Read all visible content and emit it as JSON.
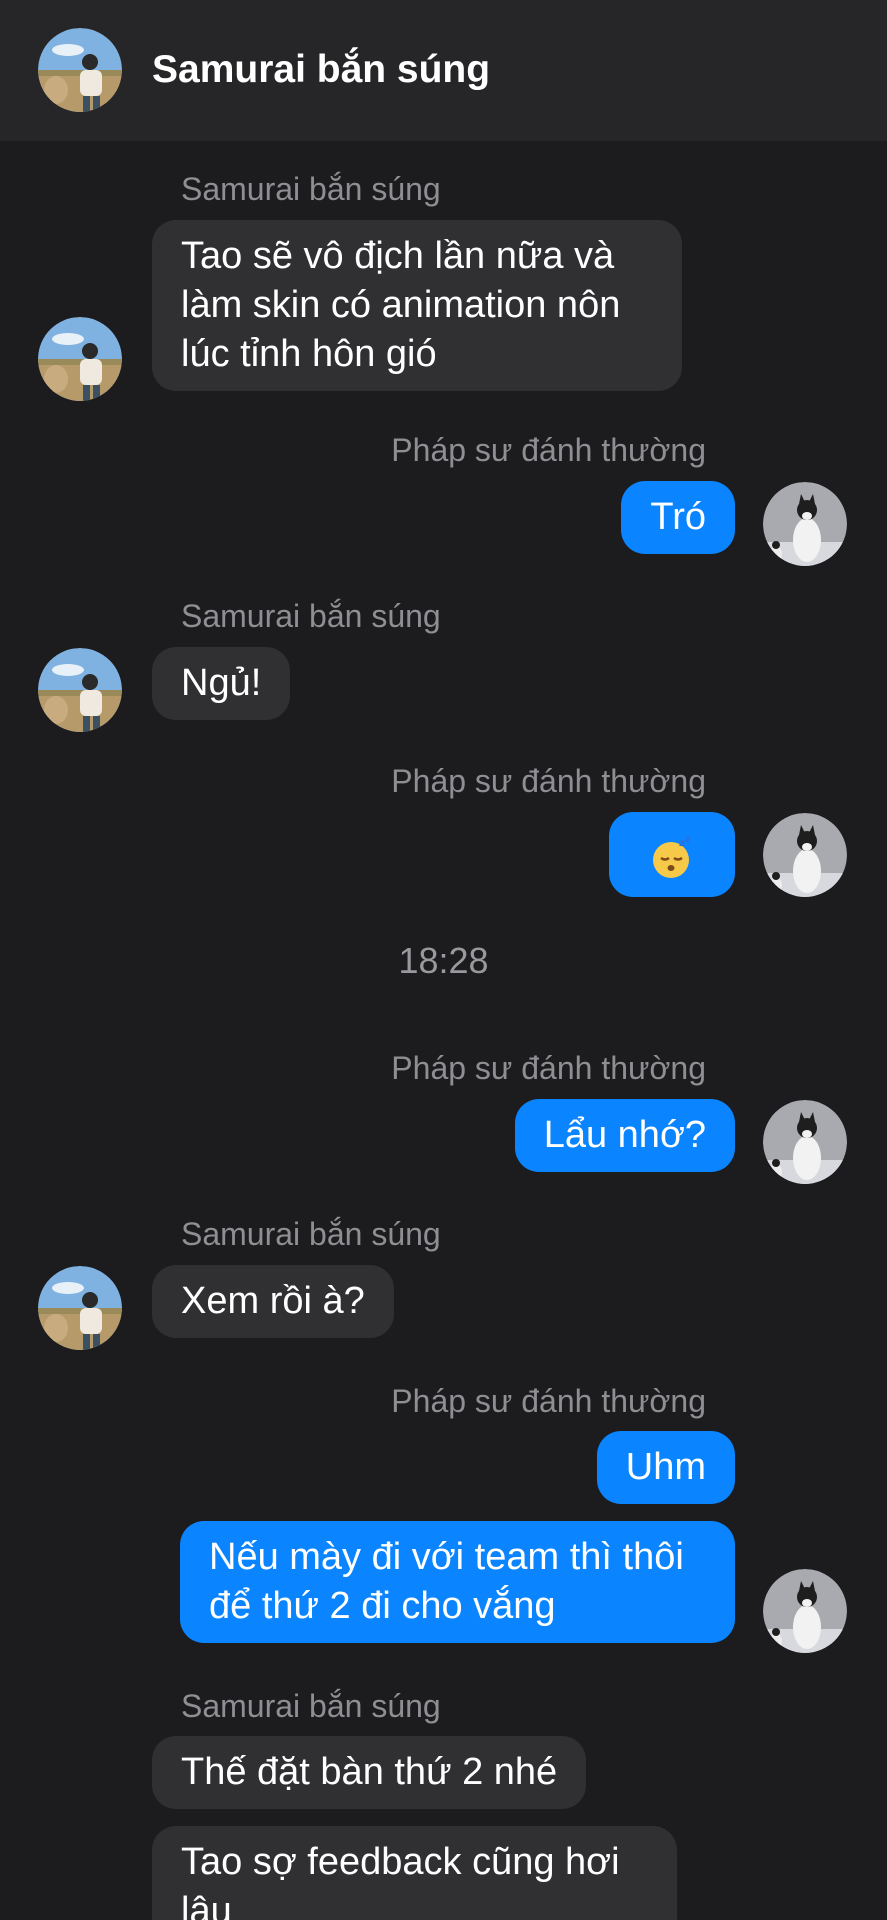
{
  "header": {
    "title": "Samurai bắn súng",
    "avatar_icon": "contact-photo-person-field"
  },
  "participants": {
    "them": {
      "name": "Samurai bắn súng",
      "avatar_icon": "person-in-field-photo"
    },
    "me": {
      "name": "Pháp sư đánh thường",
      "avatar_icon": "black-white-cat-photo"
    }
  },
  "messages": [
    {
      "sender": "Samurai bắn súng",
      "lines": [
        "Tao sẽ vô địch lần nữa và",
        "làm skin có animation nôn",
        "lúc tỉnh hôn gió"
      ]
    },
    {
      "sender": "Pháp sư đánh thường",
      "text": "Tró"
    },
    {
      "sender": "Samurai bắn súng",
      "text": "Ngủ!"
    },
    {
      "sender": "Pháp sư đánh thường",
      "emoji": "sleeping-face-emoji"
    },
    {
      "sender": "Pháp sư đánh thường",
      "text": "Lẩu nhớ?"
    },
    {
      "sender": "Samurai bắn súng",
      "text": "Xem rồi à?"
    },
    {
      "sender": "Pháp sư đánh thường",
      "text": "Uhm"
    },
    {
      "lines": [
        "Nếu mày đi với team thì thôi",
        "để thứ 2 đi cho vắng"
      ]
    },
    {
      "sender": "Samurai bắn súng",
      "text": "Thế đặt bàn thứ 2 nhé"
    },
    {
      "lines": [
        "Tao sợ feedback cũng hơi",
        "lâu"
      ]
    }
  ],
  "timestamp": "18:28",
  "colors": {
    "background": "#1c1c1e",
    "header": "#262628",
    "incoming": "#303033",
    "outgoing": "#0a84ff"
  }
}
